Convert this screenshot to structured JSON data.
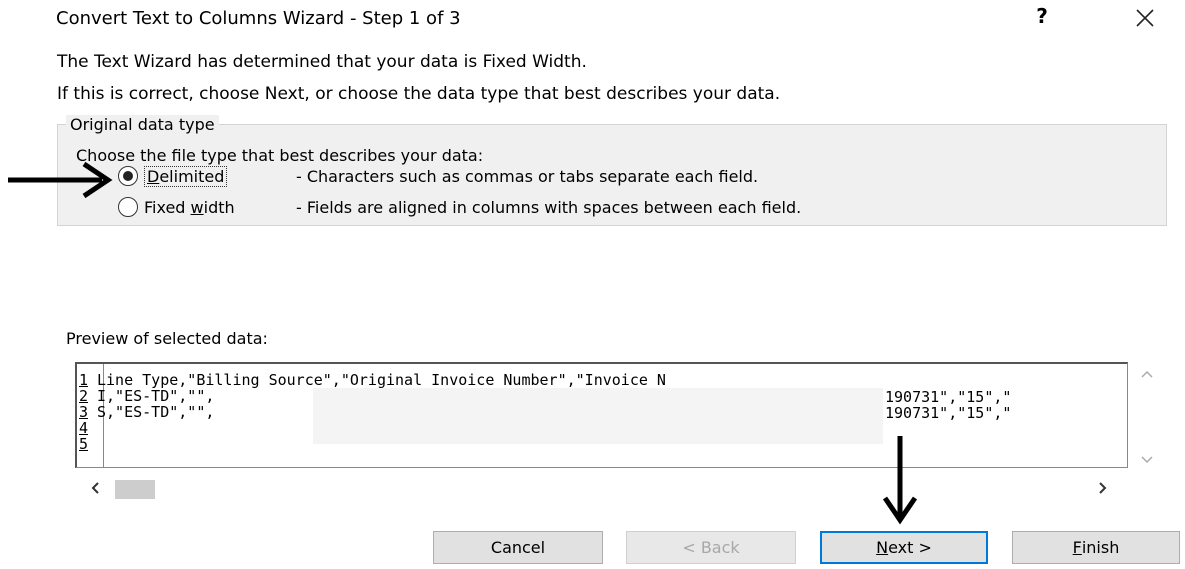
{
  "window": {
    "title": "Convert Text to Columns Wizard - Step 1 of 3",
    "help_label": "?",
    "close_icon": "close-icon"
  },
  "intro": {
    "line1": "The Text Wizard has determined that your data is Fixed Width.",
    "line2": "If this is correct, choose Next, or choose the data type that best describes your data."
  },
  "original_data_type": {
    "group_label": "Original data type",
    "prompt": "Choose the file type that best describes your data:",
    "options": [
      {
        "key": "D",
        "label_rest": "elimited",
        "label": "Delimited",
        "description": "- Characters such as commas or tabs separate each field.",
        "selected": true
      },
      {
        "pre": "Fixed ",
        "key": "w",
        "rest": "idth",
        "label": "Fixed width",
        "description": "- Fields are aligned in columns with spaces between each field.",
        "selected": false
      }
    ]
  },
  "preview": {
    "label": "Preview of selected data:",
    "rows": [
      {
        "num": "1",
        "text": "Line Type,\"Billing Source\",\"Original Invoice Number\",\"Invoice N",
        "tail": ""
      },
      {
        "num": "2",
        "text": "I,\"ES-TD\",\"\",",
        "tail": "190731\",\"15\",\""
      },
      {
        "num": "3",
        "text": "S,\"ES-TD\",\"\",",
        "tail": "190731\",\"15\",\""
      },
      {
        "num": "4",
        "text": "",
        "tail": ""
      },
      {
        "num": "5",
        "text": "",
        "tail": ""
      }
    ]
  },
  "buttons": {
    "cancel": "Cancel",
    "back": "< Back",
    "next_key": "N",
    "next_rest": "ext >",
    "finish_key": "F",
    "finish_rest": "inish"
  },
  "colors": {
    "default_button_border": "#0078d7",
    "panel_background": "#f0f0f0",
    "disabled_text": "#a8a8a8"
  }
}
